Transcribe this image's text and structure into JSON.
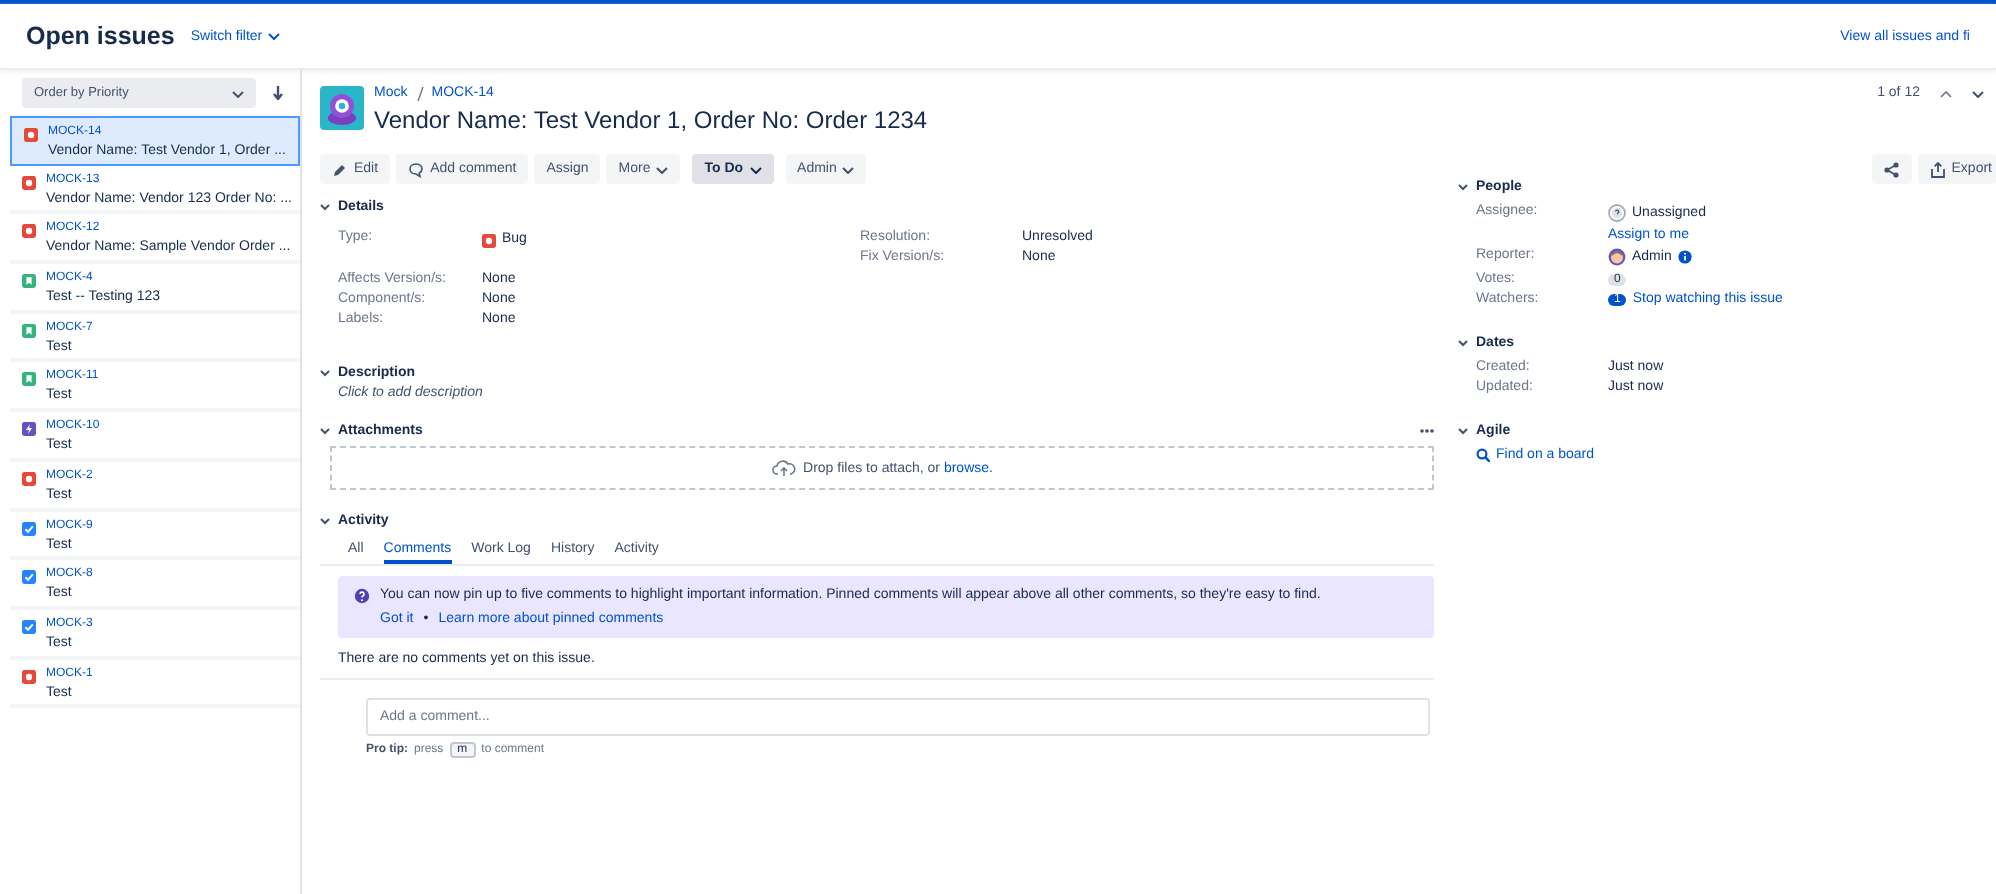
{
  "header": {
    "title": "Open issues",
    "filter_link": "Switch filter",
    "view_all": "View all issues and fi"
  },
  "sidebar": {
    "sort": "Order by Priority",
    "issues": [
      {
        "key": "MOCK-14",
        "summary": "Vendor Name: Test Vendor 1, Order ...",
        "kind": "bug",
        "selected": true
      },
      {
        "key": "MOCK-13",
        "summary": "Vendor Name: Vendor 123 Order No: ...",
        "kind": "bug",
        "selected": false
      },
      {
        "key": "MOCK-12",
        "summary": "Vendor Name: Sample Vendor Order ...",
        "kind": "bug",
        "selected": false
      },
      {
        "key": "MOCK-4",
        "summary": "Test -- Testing 123",
        "kind": "story",
        "selected": false
      },
      {
        "key": "MOCK-7",
        "summary": "Test",
        "kind": "story",
        "selected": false
      },
      {
        "key": "MOCK-11",
        "summary": "Test",
        "kind": "story",
        "selected": false
      },
      {
        "key": "MOCK-10",
        "summary": "Test",
        "kind": "epic",
        "selected": false
      },
      {
        "key": "MOCK-2",
        "summary": "Test",
        "kind": "bug",
        "selected": false
      },
      {
        "key": "MOCK-9",
        "summary": "Test",
        "kind": "task",
        "selected": false
      },
      {
        "key": "MOCK-8",
        "summary": "Test",
        "kind": "task",
        "selected": false
      },
      {
        "key": "MOCK-3",
        "summary": "Test",
        "kind": "task",
        "selected": false
      },
      {
        "key": "MOCK-1",
        "summary": "Test",
        "kind": "bug",
        "selected": false
      }
    ]
  },
  "issue": {
    "breadcrumbs": [
      "Mock",
      "MOCK-14"
    ],
    "title": "Vendor Name: Test Vendor 1, Order No: Order 1234",
    "pager": "1 of 12",
    "toolbar": [
      {
        "label": "Edit",
        "kind": "edit"
      },
      {
        "label": "Add comment",
        "kind": "comment"
      },
      {
        "label": "Assign",
        "kind": "plain"
      },
      {
        "label": "More",
        "kind": "menu"
      },
      {
        "label": "To Do",
        "kind": "status"
      },
      {
        "label": "Admin",
        "kind": "menu"
      }
    ],
    "export": "Export",
    "details": {
      "title": "Details",
      "expanded": true,
      "left": [
        [
          {
            "label": "Type:",
            "value": "Bug",
            "kind": "bug"
          }
        ],
        [
          {
            "label": "Affects Version/s:",
            "value": "None"
          },
          {
            "label": "Component/s:",
            "value": "None"
          },
          {
            "label": "Labels:",
            "value": "None"
          }
        ]
      ],
      "right": [
        {
          "label": "Resolution:",
          "value": "Unresolved"
        },
        {
          "label": "Fix Version/s:",
          "value": "None"
        }
      ]
    },
    "description": {
      "title": "Description",
      "expanded": true,
      "placeholder": "Click to add description"
    },
    "attachments": {
      "title": "Attachments",
      "expanded": true,
      "drop_text": "Drop files to attach, or ",
      "browse": "browse."
    },
    "activity": {
      "title": "Activity",
      "expanded": true,
      "tabs": [
        {
          "label": "All",
          "selected": false
        },
        {
          "label": "Comments",
          "selected": true
        },
        {
          "label": "Work Log",
          "selected": false
        },
        {
          "label": "History",
          "selected": false
        },
        {
          "label": "Activity",
          "selected": false
        }
      ],
      "banner": {
        "text": "You can now pin up to five comments to highlight important information. Pinned comments will appear above all other comments, so they're easy to find.",
        "dismiss": "Got it",
        "separator": "•",
        "learn_more": "Learn more about pinned comments"
      },
      "empty": "There are no comments yet on this issue.",
      "comment_placeholder": "Add a comment...",
      "tip": {
        "label": "Pro tip:",
        "before": "press",
        "key": "m",
        "after": "to comment"
      }
    },
    "people": {
      "title": "People",
      "expanded": true,
      "assignee": {
        "label": "Assignee:",
        "value": "Unassigned",
        "action": "Assign to me"
      },
      "reporter": {
        "label": "Reporter:",
        "value": "Admin"
      },
      "votes": {
        "label": "Votes:",
        "count": "0"
      },
      "watchers": {
        "label": "Watchers:",
        "count": "1",
        "action": "Stop watching this issue"
      }
    },
    "dates": {
      "title": "Dates",
      "expanded": true,
      "rows": [
        {
          "label": "Created:",
          "value": "Just now"
        },
        {
          "label": "Updated:",
          "value": "Just now"
        }
      ]
    },
    "agile": {
      "title": "Agile",
      "expanded": true,
      "link": "Find on a board"
    }
  }
}
